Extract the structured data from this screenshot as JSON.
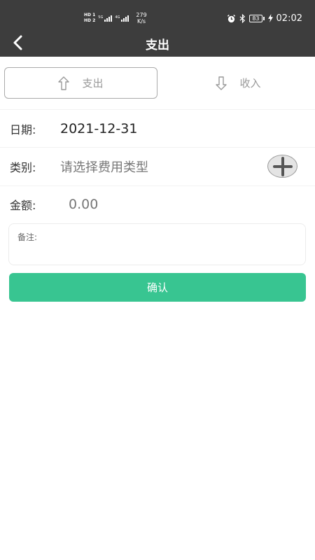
{
  "statusbar": {
    "hd1": "HD 1",
    "hd2": "HD 2",
    "sig1_gen": "5G",
    "sig2_gen": "4G",
    "speed_value": "279",
    "speed_unit": "K/s",
    "battery": "83",
    "time": "02:02"
  },
  "header": {
    "title": "支出"
  },
  "tabs": {
    "expense_label": "支出",
    "income_label": "收入"
  },
  "form": {
    "date_label": "日期:",
    "date_value": "2021-12-31",
    "category_label": "类别:",
    "category_placeholder": "请选择费用类型",
    "amount_label": "金额:",
    "amount_value": "0.00",
    "note_label": "备注:"
  },
  "confirm_label": "确认",
  "colors": {
    "bar": "#3d3d3d",
    "accent": "#38c591"
  },
  "icons": {
    "back": "chevron-left-icon",
    "expense": "arrow-up-icon",
    "income": "arrow-down-icon",
    "add": "plus-icon"
  }
}
